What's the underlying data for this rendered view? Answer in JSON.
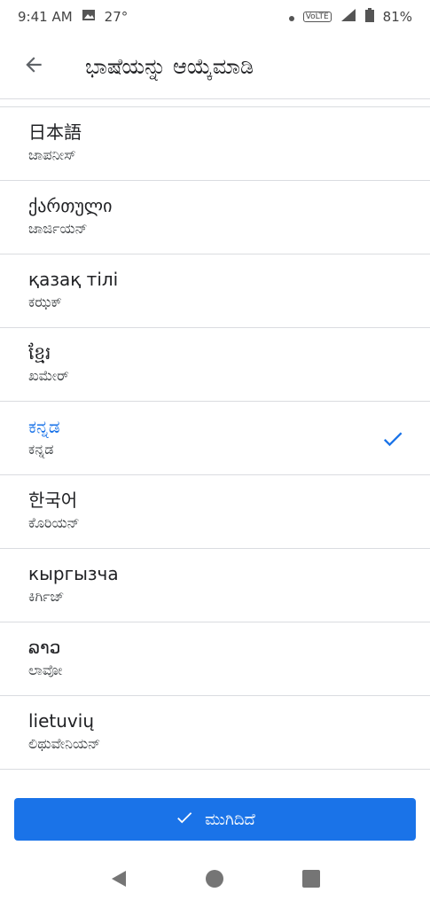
{
  "status_bar": {
    "time": "9:41 AM",
    "temperature": "27°",
    "battery": "81%",
    "network_label": "VoLTE"
  },
  "app_bar": {
    "title": "ಭಾಷೆಯನ್ನು ಆಯ್ಕೆಮಾಡಿ",
    "back_icon": "arrow-back-icon"
  },
  "languages": [
    {
      "native": "日本語",
      "label": "ಜಾಪನೀಸ್",
      "selected": false
    },
    {
      "native": "ქართული",
      "label": "ಜಾರ್ಜಿಯನ್",
      "selected": false
    },
    {
      "native": "қазақ тілі",
      "label": "ಕಝಕ್",
      "selected": false
    },
    {
      "native": "ខ្មែរ",
      "label": "ಖಮೇರ್",
      "selected": false
    },
    {
      "native": "ಕನ್ನಡ",
      "label": "ಕನ್ನಡ",
      "selected": true
    },
    {
      "native": "한국어",
      "label": "ಕೊರಿಯನ್",
      "selected": false
    },
    {
      "native": "кыргызча",
      "label": "ಕಿರ್ಗಿಜ್",
      "selected": false
    },
    {
      "native": "ລາວ",
      "label": "ಲಾವೋ",
      "selected": false
    },
    {
      "native": "lietuvių",
      "label": "ಲಿಥುವೇನಿಯನ್",
      "selected": false
    }
  ],
  "done_button": {
    "label": "ಮುಗಿದಿದೆ"
  },
  "colors": {
    "accent": "#1a73e8",
    "divider": "#dadce0"
  }
}
